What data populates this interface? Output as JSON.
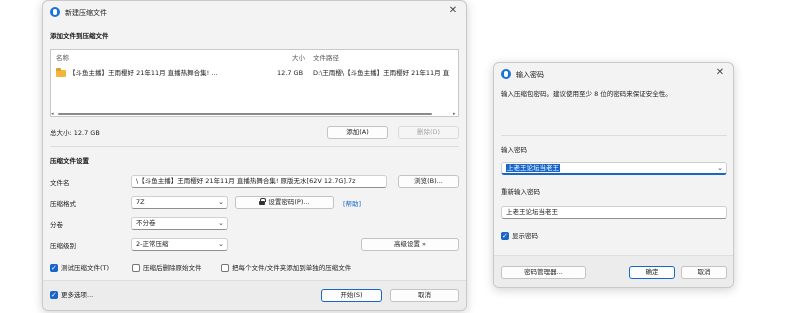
{
  "main_window": {
    "title": "新建压缩文件",
    "add_section_title": "添加文件到压缩文件",
    "columns": {
      "name": "名称",
      "size": "大小",
      "path": "文件路径"
    },
    "files": [
      {
        "name": "【斗鱼主播】王雨樱好 21年11月 直播热舞合集! ...",
        "size": "12.7 GB",
        "path": "D:\\王雨樱\\【斗鱼主播】王雨樱好 21年11月 直"
      }
    ],
    "total_size": "总大小: 12.7 GB",
    "add_button": "添加(A)",
    "remove_button": "删除(D)",
    "settings_title": "压缩文件设置",
    "filename_label": "文件名",
    "filename_value": "\\【斗鱼主播】王雨樱好 21年11月 直播热舞合集! 原版无水[62V 12.7G].7z",
    "browse_button": "浏览(B)...",
    "format_label": "压缩格式",
    "format_value": "7Z",
    "set_password_button": "设置密码(P)...",
    "help_link": "[帮助]",
    "split_label": "分卷",
    "split_value": "不分卷",
    "level_label": "压缩级别",
    "level_value": "2-正常压缩",
    "advanced_button": "高级设置 »",
    "test_checkbox": "测试压缩文件(T)",
    "delete_checkbox": "压缩后删除原始文件",
    "separate_checkbox": "把每个文件/文件夹添加到单独的压缩文件",
    "more_options": "更多选项...",
    "start_button": "开始(S)",
    "cancel_button": "取消"
  },
  "password_dialog": {
    "title": "输入密码",
    "hint": "输入压缩包密码。建议使用至少 8 位的密码来保证安全性。",
    "password_label": "输入密码",
    "password_value": "上老王论坛当老王",
    "confirm_label": "重新输入密码",
    "confirm_value": "上老王论坛当老王",
    "show_password": "显示密码",
    "manager_button": "密码管理器...",
    "ok_button": "确定",
    "cancel_button": "取消"
  },
  "colors": {
    "accent": "#1a66c8",
    "app_icon": "#1a73d9",
    "window_bg": "#f3f3f3"
  },
  "icons": [
    "app-logo-icon",
    "close-icon",
    "folder-icon",
    "lock-icon",
    "chevron-down-icon",
    "checkmark-icon"
  ]
}
